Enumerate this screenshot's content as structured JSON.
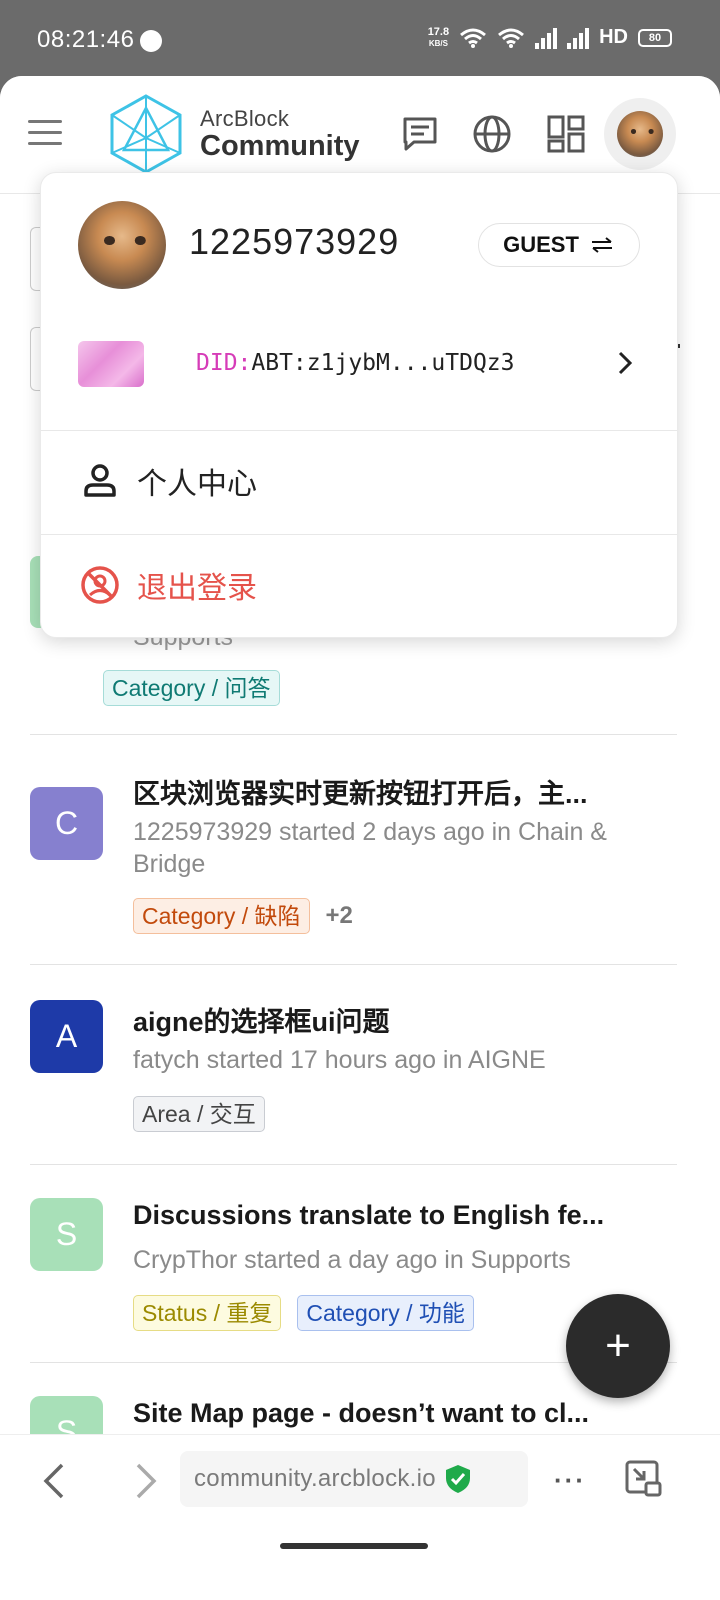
{
  "status_bar": {
    "time": "08:21:46",
    "net_speed_value": "17.8",
    "net_speed_unit": "KB/S",
    "network_label": "HD",
    "battery": "80"
  },
  "header": {
    "brand_top": "ArcBlock",
    "brand_bottom": "Community",
    "icons": [
      "menu-icon",
      "chat-icon",
      "globe-icon",
      "apps-grid-icon",
      "avatar"
    ]
  },
  "user_menu": {
    "username": "1225973929",
    "role_badge": "GUEST",
    "did_prefix": "DID:",
    "did_value": "ABT:z1jybM...uTDQz3",
    "profile_label": "个人中心",
    "logout_label": "退出登录",
    "logout_color": "#e5534b"
  },
  "posts": [
    {
      "meta_partial": "Supports",
      "tags": [
        {
          "text": "Category / 问答",
          "kind": "teal"
        }
      ]
    },
    {
      "avatar_letter": "C",
      "avatar_color": "#8680cf",
      "title": "区块浏览器实时更新按钮打开后，主...",
      "meta": "1225973929 started 2 days ago in Chain & Bridge",
      "tags": [
        {
          "text": "Category / 缺陷",
          "kind": "orange"
        }
      ],
      "more": "+2"
    },
    {
      "avatar_letter": "A",
      "avatar_color": "#1e3aa8",
      "title": "aigne的选择框ui问题",
      "meta": "fatych started 17 hours ago in AIGNE",
      "tags": [
        {
          "text": "Area / 交互",
          "kind": "gray"
        }
      ]
    },
    {
      "avatar_letter": "S",
      "avatar_color": "#a8e0b8",
      "title": "Discussions translate to English fe...",
      "meta": "CrypThor started a day ago in Supports",
      "tags": [
        {
          "text": "Status / 重复",
          "kind": "yellow"
        },
        {
          "text": "Category / 功能",
          "kind": "blue"
        }
      ]
    },
    {
      "avatar_letter": "S",
      "avatar_color": "#a8e0b8",
      "title": "Site Map page - doesn’t want to cl..."
    }
  ],
  "fab": {
    "label": "+"
  },
  "browser": {
    "url": "community.arcblock.io",
    "more": "···"
  }
}
